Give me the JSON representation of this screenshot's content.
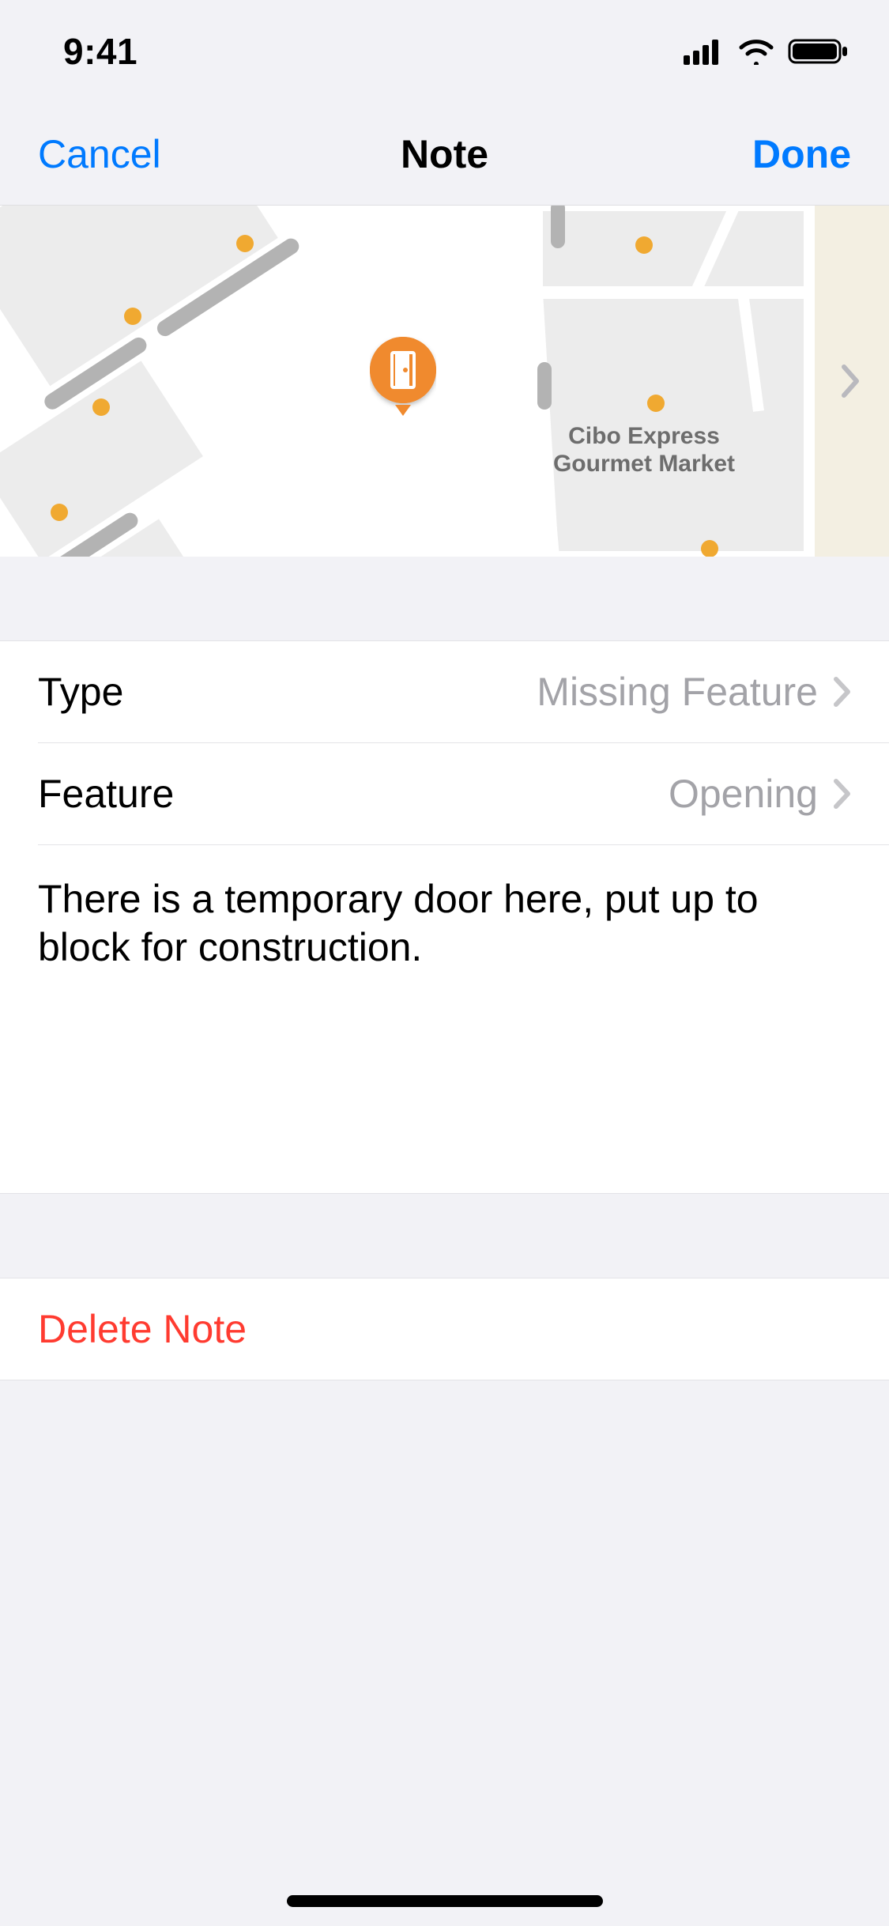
{
  "status": {
    "time": "9:41"
  },
  "nav": {
    "cancel_label": "Cancel",
    "title": "Note",
    "done_label": "Done"
  },
  "map": {
    "poi_label": "Cibo Express\nGourmet Market",
    "marker_icon": "door-icon"
  },
  "rows": {
    "type": {
      "label": "Type",
      "value": "Missing Feature"
    },
    "feature": {
      "label": "Feature",
      "value": "Opening"
    }
  },
  "note_text": "There is a temporary door here, put up to block for construction.",
  "delete_label": "Delete Note"
}
